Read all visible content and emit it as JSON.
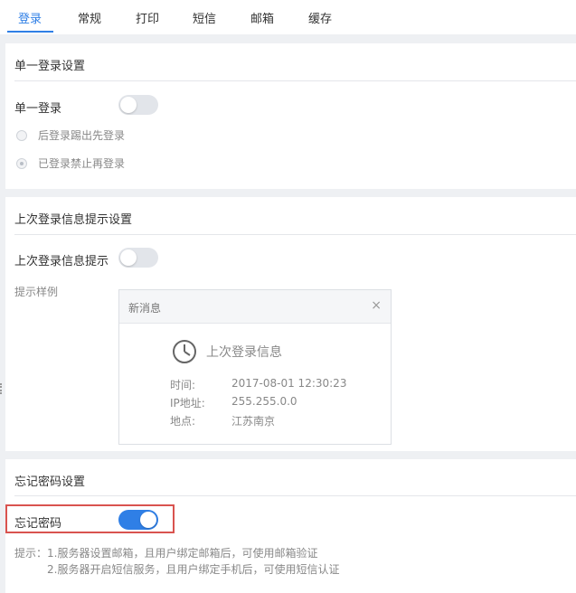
{
  "tabs": [
    {
      "label": "登录",
      "active": true
    },
    {
      "label": "常规"
    },
    {
      "label": "打印"
    },
    {
      "label": "短信"
    },
    {
      "label": "邮箱"
    },
    {
      "label": "缓存"
    }
  ],
  "single_login": {
    "title": "单一登录设置",
    "toggle_label": "单一登录",
    "toggle_on": false,
    "options": [
      {
        "label": "后登录踢出先登录",
        "checked": false
      },
      {
        "label": "已登录禁止再登录",
        "checked": true
      }
    ]
  },
  "last_login": {
    "title": "上次登录信息提示设置",
    "toggle_label": "上次登录信息提示",
    "toggle_on": false,
    "sample_label": "提示样例",
    "sample": {
      "header": "新消息",
      "close": "×",
      "heading": "上次登录信息",
      "rows": [
        {
          "key": "时间:",
          "value": "2017-08-01 12:30:23"
        },
        {
          "key": "IP地址:",
          "value": "255.255.0.0"
        },
        {
          "key": "地点:",
          "value": "江苏南京"
        }
      ]
    }
  },
  "forgot_password": {
    "title": "忘记密码设置",
    "toggle_label": "忘记密码",
    "toggle_on": true,
    "hint_line1": "提示：1.服务器设置邮箱，且用户绑定邮箱后，可使用邮箱验证",
    "hint_line2": "2.服务器开启短信服务，且用户绑定手机后，可使用短信认证"
  },
  "colors": {
    "accent": "#2f7fe6",
    "highlight": "#d9534f"
  },
  "icons": {
    "clock": "clock-icon",
    "close": "close-icon"
  }
}
